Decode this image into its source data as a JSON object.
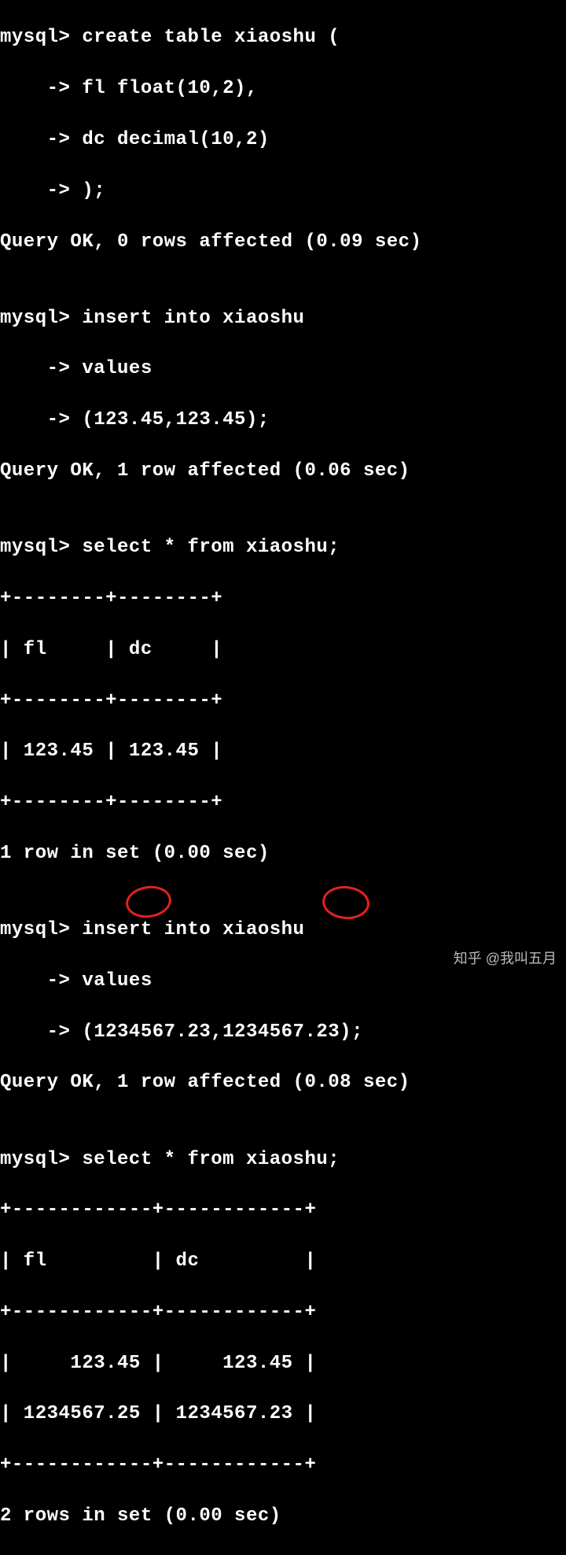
{
  "terminal": {
    "lines": [
      "mysql> create table xiaoshu (",
      "    -> fl float(10,2),",
      "    -> dc decimal(10,2)",
      "    -> );",
      "Query OK, 0 rows affected (0.09 sec)",
      "",
      "mysql> insert into xiaoshu",
      "    -> values",
      "    -> (123.45,123.45);",
      "Query OK, 1 row affected (0.06 sec)",
      "",
      "mysql> select * from xiaoshu;",
      "+--------+--------+",
      "| fl     | dc     |",
      "+--------+--------+",
      "| 123.45 | 123.45 |",
      "+--------+--------+",
      "1 row in set (0.00 sec)",
      "",
      "mysql> insert into xiaoshu",
      "    -> values",
      "    -> (1234567.23,1234567.23);",
      "Query OK, 1 row affected (0.08 sec)",
      "",
      "mysql> select * from xiaoshu;",
      "+------------+------------+",
      "| fl         | dc         |",
      "+------------+------------+",
      "|     123.45 |     123.45 |",
      "| 1234567.25 | 1234567.23 |",
      "+------------+------------+",
      "2 rows in set (0.00 sec)"
    ]
  },
  "watermark": "知乎 @我叫五月",
  "table1": {
    "headers": [
      "fl",
      "dc"
    ],
    "rows": [
      [
        "123.45",
        "123.45"
      ]
    ]
  },
  "table2": {
    "headers": [
      "fl",
      "dc"
    ],
    "rows": [
      [
        "123.45",
        "123.45"
      ],
      [
        "1234567.25",
        "1234567.23"
      ]
    ]
  },
  "annotations": {
    "highlight1": "25",
    "highlight2": "23"
  }
}
